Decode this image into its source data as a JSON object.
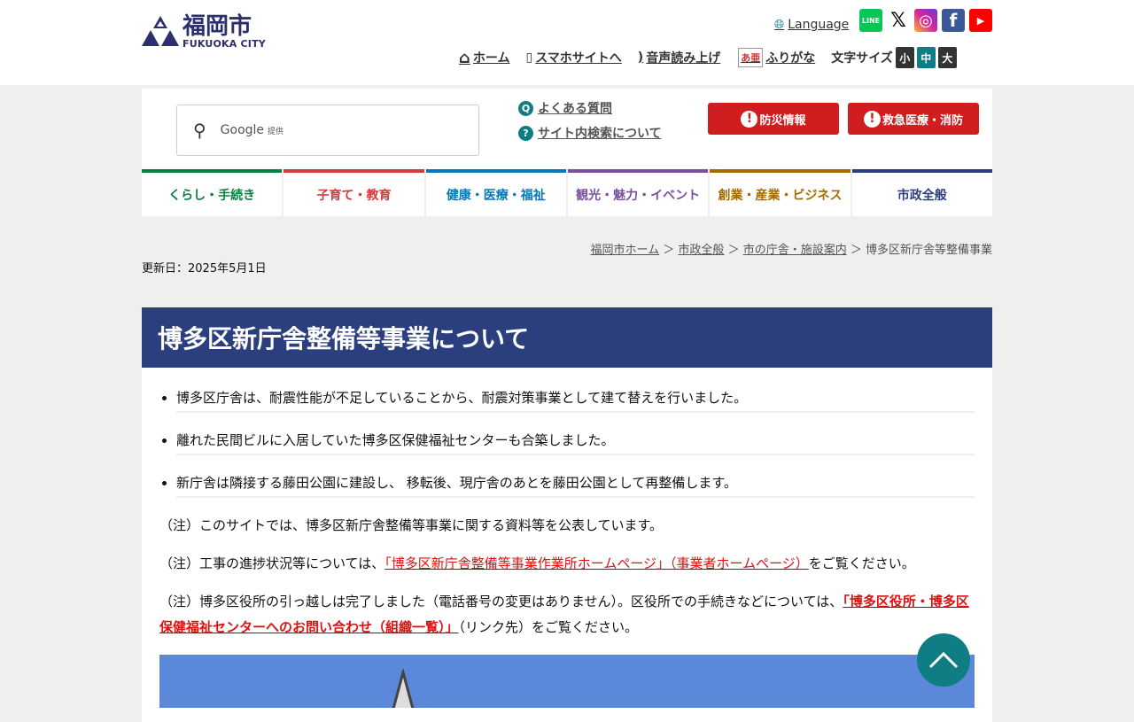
{
  "header": {
    "logo_ja": "福岡市",
    "logo_en": "FUKUOKA CITY",
    "language": "Language",
    "sns": [
      {
        "name": "line",
        "label": "LINE",
        "color": "#06c755"
      },
      {
        "name": "x",
        "label": "𝕏",
        "color": "#fff"
      },
      {
        "name": "instagram",
        "label": "◎",
        "color": "#d6249f"
      },
      {
        "name": "facebook",
        "label": "f",
        "color": "#3b5998"
      },
      {
        "name": "youtube",
        "label": "▶",
        "color": "#ff0000"
      }
    ],
    "util": {
      "home": "ホーム",
      "smartphone": "スマホサイトへ",
      "read_aloud": "音声読み上げ",
      "furigana": "ふりがな",
      "font_size": "文字サイズ",
      "small": "小",
      "medium": "中",
      "large": "大"
    }
  },
  "search": {
    "placeholder": "Google",
    "provided": "提供",
    "faq": "よくある質問",
    "about_search": "サイト内検索について",
    "disaster": "防災情報",
    "emergency": "救急医療・消防"
  },
  "gnav": [
    {
      "label": "くらし・手続き",
      "color": "#0a8040"
    },
    {
      "label": "子育て・教育",
      "color": "#d63a3a"
    },
    {
      "label": "健康・医療・福祉",
      "color": "#0a78b4"
    },
    {
      "label": "観光・魅力・イベント",
      "color": "#7b4f9d"
    },
    {
      "label": "創業・産業・ビジネス",
      "color": "#a36b00"
    },
    {
      "label": "市政全般",
      "color": "#2b3f7e"
    }
  ],
  "breadcrumb": [
    "福岡市ホーム",
    "市政全般",
    "市の庁舎・施設案内",
    "博多区新庁舎等整備事業"
  ],
  "updated": "更新日：2025年5月1日",
  "page_title": "博多区新庁舎整備等事業について",
  "bullets": [
    "博多区庁舎は、耐震性能が不足していることから、耐震対策事業として建て替えを行いました。",
    "離れた民間ビルに入居していた博多区保健福祉センターも合築しました。",
    "新庁舎は隣接する藤田公園に建設し、 移転後、現庁舎のあとを藤田公園として再整備します。"
  ],
  "notes": {
    "n1": "（注）このサイトでは、博多区新庁舎整備等事業に関する資料等を公表しています。",
    "n2_pre": "（注）工事の進捗状況等については、",
    "n2_link": "「博多区新庁舎整備等事業作業所ホームページ」（事業者ホームページ）",
    "n2_post": "をご覧ください。",
    "n3_pre": "（注）博多区役所の引っ越しは完了しました（電話番号の変更はありません）。区役所での手続きなどについては、",
    "n3_link": "「博多区役所・博多区保健福祉センターへのお問い合わせ（組織一覧）」",
    "n3_post": "（リンク先）をご覧ください。"
  }
}
